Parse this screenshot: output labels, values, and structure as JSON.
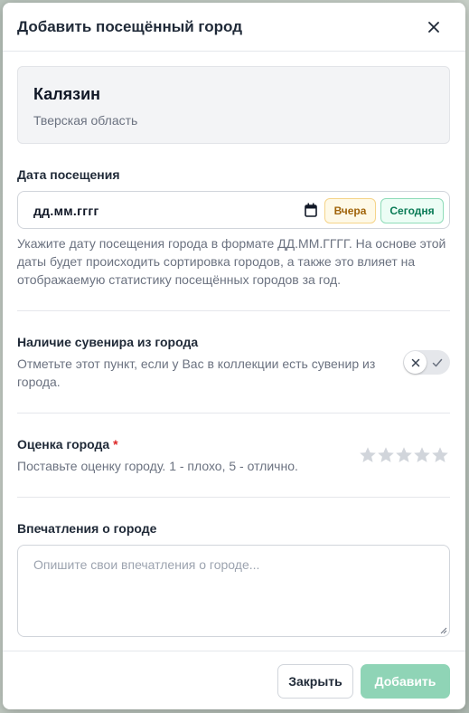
{
  "dialog": {
    "title": "Добавить посещённый город",
    "close_icon": "close-icon"
  },
  "city": {
    "name": "Калязин",
    "region": "Тверская область"
  },
  "visit_date": {
    "label": "Дата посещения",
    "value": "дд.мм.гггг",
    "calendar_icon": "calendar-icon",
    "yesterday_label": "Вчера",
    "today_label": "Сегодня",
    "hint": "Укажите дату посещения города в формате ДД.ММ.ГГГГ. На основе этой даты будет происходить сортировка городов, а также это влияет на отображаемую статистику посещённых городов за год."
  },
  "souvenir": {
    "label": "Наличие сувенира из города",
    "hint": "Отметьте этот пункт, если у Вас в коллекции есть сувенир из города.",
    "checked": false
  },
  "rating": {
    "label": "Оценка города",
    "required_mark": "*",
    "hint": "Поставьте оценку городу. 1 - плохо, 5 - отлично.",
    "max": 5,
    "value": 0
  },
  "impressions": {
    "label": "Впечатления о городе",
    "placeholder": "Опишите свои впечатления о городе..."
  },
  "footer": {
    "close_label": "Закрыть",
    "add_label": "Добавить"
  },
  "colors": {
    "accent": "#8fd4b6",
    "yesterday_bg": "#fef9e7",
    "today_bg": "#ecfdf5",
    "required": "#dc2626"
  }
}
